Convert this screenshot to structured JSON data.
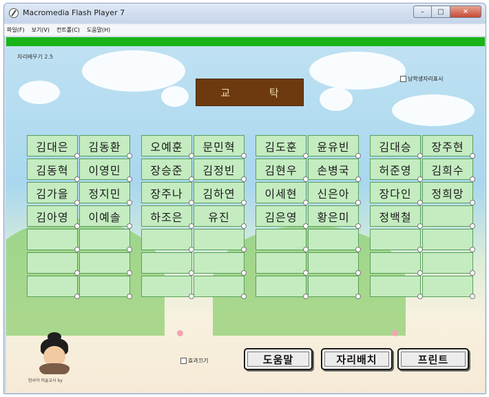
{
  "window": {
    "title": "Macromedia Flash Player 7",
    "controls": [
      "–",
      "□",
      "✕"
    ]
  },
  "menu": [
    "파일(F)",
    "보기(V)",
    "컨트롤(C)",
    "도움말(H)"
  ],
  "app": {
    "version": "자리배우기 2.5",
    "gender_toggle_label": "남학생자리표시",
    "desk_label": "교 탁",
    "effect_toggle_label": "효과끄기",
    "avatar_caption": "밤사야 미술교사 by",
    "buttons": {
      "help": "도움말",
      "arrange": "자리배치",
      "print": "프린트"
    }
  },
  "seating": {
    "rows": [
      [
        "김대은",
        "김동환",
        "오예훈",
        "문민혁",
        "김도훈",
        "윤유빈",
        "김대승",
        "장주현"
      ],
      [
        "김동혁",
        "이영민",
        "장승준",
        "김정빈",
        "김현우",
        "손병국",
        "허준영",
        "김희수"
      ],
      [
        "김가을",
        "정지민",
        "장주나",
        "김하연",
        "이세현",
        "신은아",
        "장다인",
        "정희망"
      ],
      [
        "김아영",
        "이예솔",
        "하조은",
        "유진",
        "김은영",
        "황은미",
        "정백철",
        ""
      ],
      [
        "",
        "",
        "",
        "",
        "",
        "",
        "",
        ""
      ],
      [
        "",
        "",
        "",
        "",
        "",
        "",
        "",
        ""
      ],
      [
        "",
        "",
        "",
        "",
        "",
        "",
        "",
        ""
      ]
    ]
  },
  "colors": {
    "accent_green": "#18b418",
    "desk_brown": "#6c3a0e",
    "seat_fill": "#c4ecc0"
  }
}
